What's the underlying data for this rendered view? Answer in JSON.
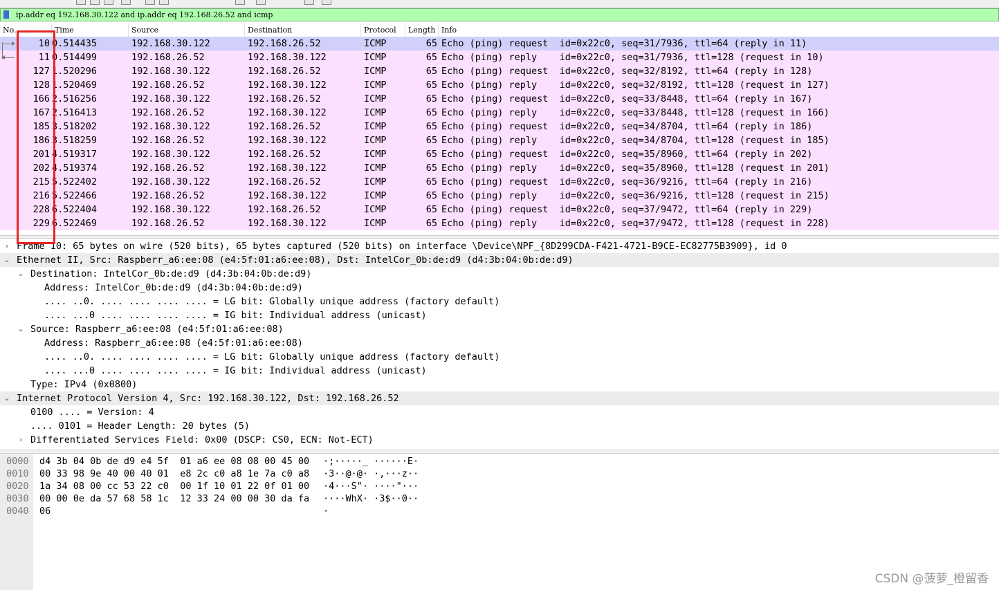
{
  "display_filter": {
    "value": "ip.addr eq 192.168.30.122 and ip.addr eq 192.168.26.52 and icmp"
  },
  "packet_list": {
    "columns": [
      "No.",
      "Time",
      "Source",
      "Destination",
      "Protocol",
      "Length",
      "Info"
    ],
    "rows": [
      {
        "no": "10",
        "time": "0.514435",
        "src": "192.168.30.122",
        "dst": "192.168.26.52",
        "proto": "ICMP",
        "len": "65",
        "info": "Echo (ping) request  id=0x22c0, seq=31/7936, ttl=64 (reply in 11)",
        "selected": true
      },
      {
        "no": "11",
        "time": "0.514499",
        "src": "192.168.26.52",
        "dst": "192.168.30.122",
        "proto": "ICMP",
        "len": "65",
        "info": "Echo (ping) reply    id=0x22c0, seq=31/7936, ttl=128 (request in 10)"
      },
      {
        "no": "127",
        "time": "1.520296",
        "src": "192.168.30.122",
        "dst": "192.168.26.52",
        "proto": "ICMP",
        "len": "65",
        "info": "Echo (ping) request  id=0x22c0, seq=32/8192, ttl=64 (reply in 128)"
      },
      {
        "no": "128",
        "time": "1.520469",
        "src": "192.168.26.52",
        "dst": "192.168.30.122",
        "proto": "ICMP",
        "len": "65",
        "info": "Echo (ping) reply    id=0x22c0, seq=32/8192, ttl=128 (request in 127)"
      },
      {
        "no": "166",
        "time": "2.516256",
        "src": "192.168.30.122",
        "dst": "192.168.26.52",
        "proto": "ICMP",
        "len": "65",
        "info": "Echo (ping) request  id=0x22c0, seq=33/8448, ttl=64 (reply in 167)"
      },
      {
        "no": "167",
        "time": "2.516413",
        "src": "192.168.26.52",
        "dst": "192.168.30.122",
        "proto": "ICMP",
        "len": "65",
        "info": "Echo (ping) reply    id=0x22c0, seq=33/8448, ttl=128 (request in 166)"
      },
      {
        "no": "185",
        "time": "3.518202",
        "src": "192.168.30.122",
        "dst": "192.168.26.52",
        "proto": "ICMP",
        "len": "65",
        "info": "Echo (ping) request  id=0x22c0, seq=34/8704, ttl=64 (reply in 186)"
      },
      {
        "no": "186",
        "time": "3.518259",
        "src": "192.168.26.52",
        "dst": "192.168.30.122",
        "proto": "ICMP",
        "len": "65",
        "info": "Echo (ping) reply    id=0x22c0, seq=34/8704, ttl=128 (request in 185)"
      },
      {
        "no": "201",
        "time": "4.519317",
        "src": "192.168.30.122",
        "dst": "192.168.26.52",
        "proto": "ICMP",
        "len": "65",
        "info": "Echo (ping) request  id=0x22c0, seq=35/8960, ttl=64 (reply in 202)"
      },
      {
        "no": "202",
        "time": "4.519374",
        "src": "192.168.26.52",
        "dst": "192.168.30.122",
        "proto": "ICMP",
        "len": "65",
        "info": "Echo (ping) reply    id=0x22c0, seq=35/8960, ttl=128 (request in 201)"
      },
      {
        "no": "215",
        "time": "5.522402",
        "src": "192.168.30.122",
        "dst": "192.168.26.52",
        "proto": "ICMP",
        "len": "65",
        "info": "Echo (ping) request  id=0x22c0, seq=36/9216, ttl=64 (reply in 216)"
      },
      {
        "no": "216",
        "time": "5.522466",
        "src": "192.168.26.52",
        "dst": "192.168.30.122",
        "proto": "ICMP",
        "len": "65",
        "info": "Echo (ping) reply    id=0x22c0, seq=36/9216, ttl=128 (request in 215)"
      },
      {
        "no": "228",
        "time": "6.522404",
        "src": "192.168.30.122",
        "dst": "192.168.26.52",
        "proto": "ICMP",
        "len": "65",
        "info": "Echo (ping) request  id=0x22c0, seq=37/9472, ttl=64 (reply in 229)"
      },
      {
        "no": "229",
        "time": "6.522469",
        "src": "192.168.26.52",
        "dst": "192.168.30.122",
        "proto": "ICMP",
        "len": "65",
        "info": "Echo (ping) reply    id=0x22c0, seq=37/9472, ttl=128 (request in 228)"
      }
    ]
  },
  "details": {
    "lines": [
      {
        "text": "Frame 10: 65 bytes on wire (520 bits), 65 bytes captured (520 bits) on interface \\Device\\NPF_{8D299CDA-F421-4721-B9CE-EC82775B3909}, id 0",
        "depth": 0,
        "expander": "collapsed"
      },
      {
        "text": "Ethernet II, Src: Raspberr_a6:ee:08 (e4:5f:01:a6:ee:08), Dst: IntelCor_0b:de:d9 (d4:3b:04:0b:de:d9)",
        "depth": 0,
        "expander": "expanded",
        "shade": true
      },
      {
        "text": "Destination: IntelCor_0b:de:d9 (d4:3b:04:0b:de:d9)",
        "depth": 1,
        "expander": "expanded"
      },
      {
        "text": "Address: IntelCor_0b:de:d9 (d4:3b:04:0b:de:d9)",
        "depth": 2,
        "expander": "none"
      },
      {
        "text": ".... ..0. .... .... .... .... = LG bit: Globally unique address (factory default)",
        "depth": 2,
        "expander": "none"
      },
      {
        "text": ".... ...0 .... .... .... .... = IG bit: Individual address (unicast)",
        "depth": 2,
        "expander": "none"
      },
      {
        "text": "Source: Raspberr_a6:ee:08 (e4:5f:01:a6:ee:08)",
        "depth": 1,
        "expander": "expanded"
      },
      {
        "text": "Address: Raspberr_a6:ee:08 (e4:5f:01:a6:ee:08)",
        "depth": 2,
        "expander": "none"
      },
      {
        "text": ".... ..0. .... .... .... .... = LG bit: Globally unique address (factory default)",
        "depth": 2,
        "expander": "none"
      },
      {
        "text": ".... ...0 .... .... .... .... = IG bit: Individual address (unicast)",
        "depth": 2,
        "expander": "none"
      },
      {
        "text": "Type: IPv4 (0x0800)",
        "depth": 1,
        "expander": "none"
      },
      {
        "text": "Internet Protocol Version 4, Src: 192.168.30.122, Dst: 192.168.26.52",
        "depth": 0,
        "expander": "expanded",
        "shade": true
      },
      {
        "text": "0100 .... = Version: 4",
        "depth": 1,
        "expander": "none"
      },
      {
        "text": ".... 0101 = Header Length: 20 bytes (5)",
        "depth": 1,
        "expander": "none"
      },
      {
        "text": "Differentiated Services Field: 0x00 (DSCP: CS0, ECN: Not-ECT)",
        "depth": 1,
        "expander": "collapsed"
      }
    ]
  },
  "hex": {
    "rows": [
      {
        "offset": "0000",
        "bytes": "d4 3b 04 0b de d9 e4 5f  01 a6 ee 08 08 00 45 00",
        "ascii": "·;·····_ ······E·"
      },
      {
        "offset": "0010",
        "bytes": "00 33 98 9e 40 00 40 01  e8 2c c0 a8 1e 7a c0 a8",
        "ascii": "·3··@·@· ·,···z··"
      },
      {
        "offset": "0020",
        "bytes": "1a 34 08 00 cc 53 22 c0  00 1f 10 01 22 0f 01 00",
        "ascii": "·4···S\"· ····\"···"
      },
      {
        "offset": "0030",
        "bytes": "00 00 0e da 57 68 58 1c  12 33 24 00 00 30 da fa",
        "ascii": "····WhX· ·3$··0··"
      },
      {
        "offset": "0040",
        "bytes": "06",
        "ascii": "·"
      }
    ]
  },
  "watermark": "CSDN @菠萝_橙留香",
  "colors": {
    "row_bg": "#fce0ff",
    "row_selected": "#d0d0fa",
    "filter_bg": "#afffaf",
    "highlight": "#e52424"
  }
}
